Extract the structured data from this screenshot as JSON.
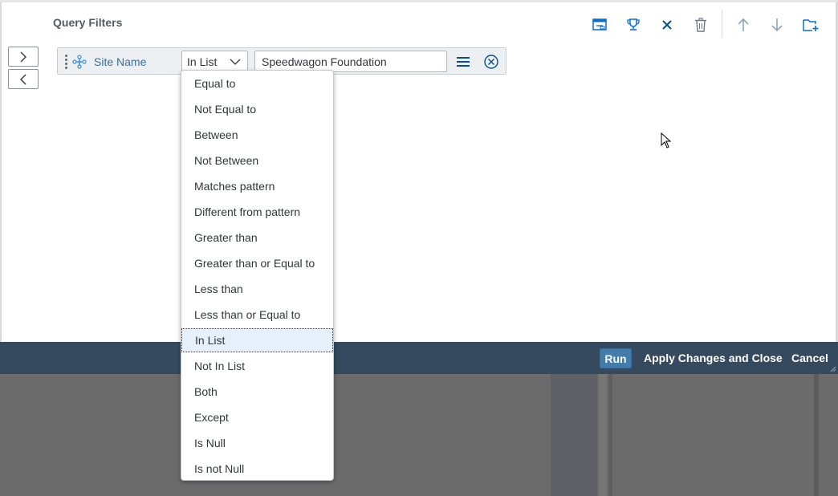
{
  "dialog": {
    "title": "Query Filters"
  },
  "toolbar": {
    "icons": [
      "window-icon",
      "trophy-icon",
      "close-icon",
      "trash-icon",
      "arrow-up-icon",
      "arrow-down-icon",
      "add-folder-icon"
    ]
  },
  "side_buttons": {
    "next": ">",
    "prev": "<"
  },
  "filter": {
    "field_name": "Site Name",
    "operator": "In List",
    "value": "Speedwagon Foundation"
  },
  "dropdown": {
    "options": [
      "Equal to",
      "Not Equal to",
      "Between",
      "Not Between",
      "Matches pattern",
      "Different from pattern",
      "Greater than",
      "Greater than or Equal to",
      "Less than",
      "Less than or Equal to",
      "In List",
      "Not In List",
      "Both",
      "Except",
      "Is Null",
      "Is not Null"
    ],
    "selected": "In List"
  },
  "footer": {
    "run_label": "Run",
    "apply_label": "Apply Changes and Close",
    "cancel_label": "Cancel"
  },
  "colors": {
    "footer_bg": "#354a5f",
    "run_button": "#427cac",
    "field_name": "#3a6e9c",
    "selected_option_bg": "#e5f0fa"
  }
}
